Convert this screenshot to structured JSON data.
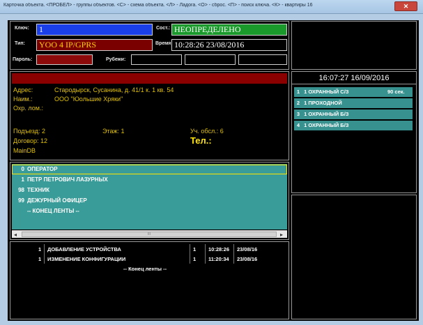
{
  "window": {
    "title": "Карточка объекта. <ПРОБЕЛ> - группы объектов. <C> - схема объекта. <Л> - Ладога. <O> - сброс. <П> - поиск ключа. <К> - квартиры 16",
    "close_glyph": "✕"
  },
  "form": {
    "key_label": "Ключ:",
    "key_value": "1",
    "state_label": "Сост.:",
    "state_value": "НЕОПРЕДЕЛЕНО",
    "type_label": "Тип:",
    "type_value": "YOO 4 IP/GPRS",
    "time_label": "Время:",
    "time_value": "10:28:26 23/08/2016",
    "password_label": "Пароль:",
    "password_value": "",
    "frontier_label": "Рубежи:"
  },
  "info": {
    "address_label": "Адрес:",
    "address_value": "Стародырск, Сусанина, д. 41/1 к. 1 кв. 54",
    "name_label": "Наим.:",
    "name_value": "ООО \"Юольшие Хряки\"",
    "guard_label": "Охр. лом.:",
    "entrance": "Подъезд: 2",
    "floor": "Этаж: 1",
    "section": "Уч. обсл.: 6",
    "contract": "Договор: 12",
    "phone": "Тел.:",
    "maindb": "MainDB"
  },
  "contacts": [
    {
      "num": "0",
      "name": "ОПЕРАТОР"
    },
    {
      "num": "1",
      "name": "ПЕТР ПЕТРОВИЧ ЛАЗУРНЫХ"
    },
    {
      "num": "98",
      "name": "ТЕХНИК"
    },
    {
      "num": "99",
      "name": "ДЕЖУРНЫЙ ОФИЦЕР"
    },
    {
      "num": "",
      "name": "-- КОНЕЦ ЛЕНТЫ --"
    }
  ],
  "scroll": {
    "left": "◂",
    "right": "▸",
    "grip": "III"
  },
  "log": {
    "rows": [
      {
        "n": "1",
        "event": "ДОБАВЛЕНИЕ УСТРОЙСТВА",
        "code": "1",
        "time": "10:28:26",
        "date": "23/08/16"
      },
      {
        "n": "1",
        "event": "ИЗМЕНЕНИЕ КОНФИГУРАЦИИ",
        "code": "1",
        "time": "11:20:34",
        "date": "23/08/16"
      }
    ],
    "end": "-- Конец ленты --"
  },
  "right": {
    "clock": "16:07:27 16/09/2016",
    "zones": [
      {
        "idx": "1",
        "label": "1  ОХРАННЫЙ С/З",
        "extra": "90 сек."
      },
      {
        "idx": "2",
        "label": "1  ПРОХОДНОЙ",
        "extra": ""
      },
      {
        "idx": "3",
        "label": "1  ОХРАННЫЙ Б/З",
        "extra": ""
      },
      {
        "idx": "4",
        "label": "1  ОХРАННЫЙ Б/З",
        "extra": ""
      }
    ]
  },
  "colors": {
    "key_bg": "#1a3fe8",
    "state_bg": "#1a9a2b",
    "type_bg": "#7a0000",
    "password_bg": "#8c0a0a",
    "teal": "#3a9c98",
    "yellow": "#e0c000"
  }
}
